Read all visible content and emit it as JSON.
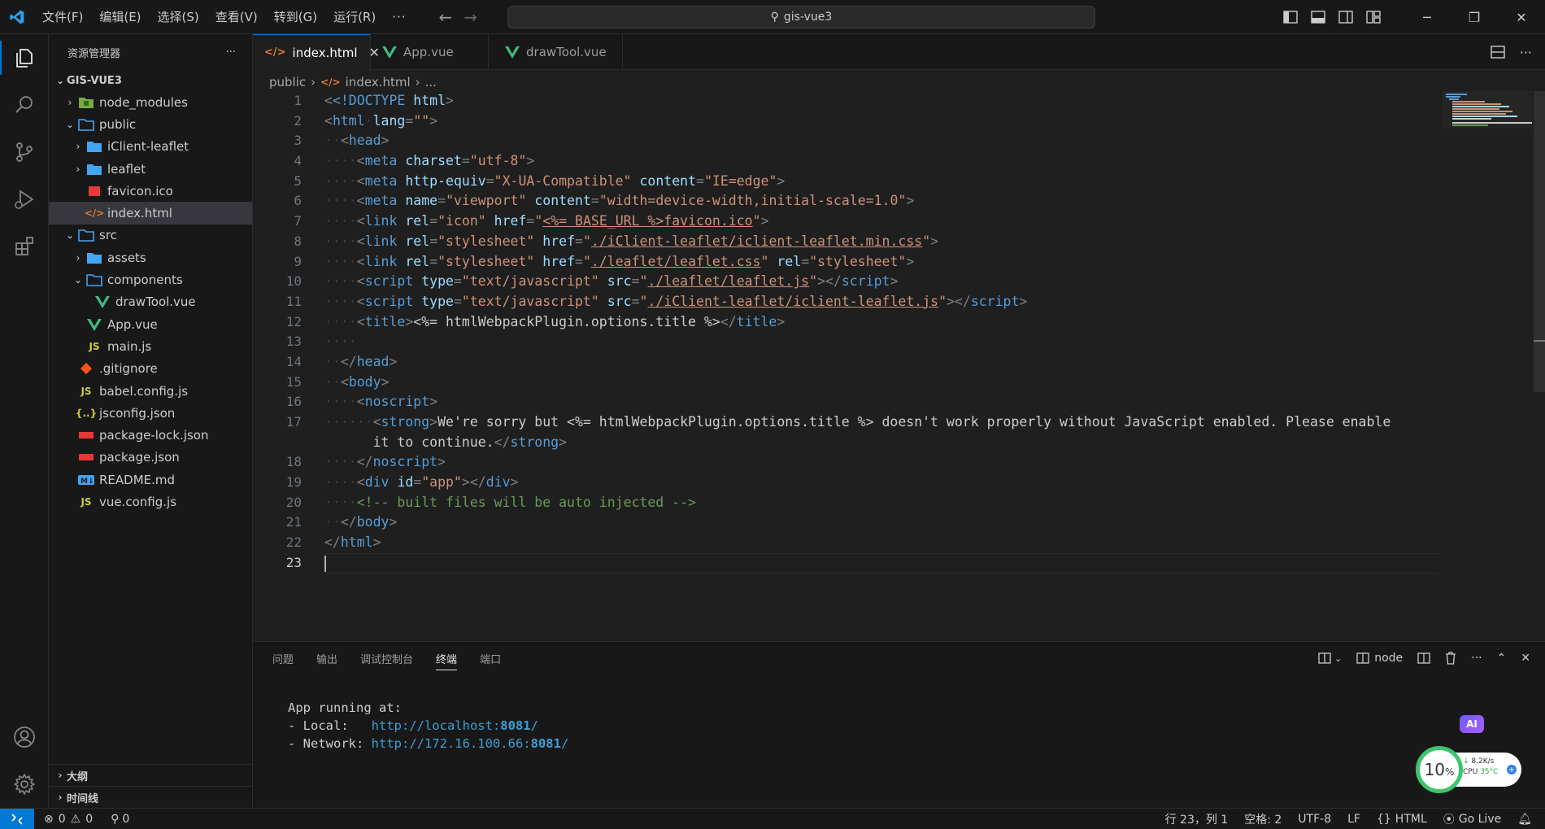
{
  "menu": [
    "文件(F)",
    "编辑(E)",
    "选择(S)",
    "查看(V)",
    "转到(G)",
    "运行(R)",
    "···"
  ],
  "search": {
    "text": "gis-vue3"
  },
  "explorer": {
    "title": "资源管理器",
    "root": "GIS-VUE3",
    "items": [
      {
        "label": "node_modules"
      },
      {
        "label": "public"
      },
      {
        "label": "iClient-leaflet"
      },
      {
        "label": "leaflet"
      },
      {
        "label": "favicon.ico"
      },
      {
        "label": "index.html"
      },
      {
        "label": "src"
      },
      {
        "label": "assets"
      },
      {
        "label": "components"
      },
      {
        "label": "drawTool.vue"
      },
      {
        "label": "App.vue"
      },
      {
        "label": "main.js"
      },
      {
        "label": ".gitignore"
      },
      {
        "label": "babel.config.js"
      },
      {
        "label": "jsconfig.json"
      },
      {
        "label": "package-lock.json"
      },
      {
        "label": "package.json"
      },
      {
        "label": "README.md"
      },
      {
        "label": "vue.config.js"
      }
    ],
    "outline": "大纲",
    "timeline": "时间线"
  },
  "tabs": [
    {
      "label": "index.html"
    },
    {
      "label": "App.vue"
    },
    {
      "label": "drawTool.vue"
    }
  ],
  "breadcrumb": {
    "folder": "public",
    "file": "index.html",
    "more": "..."
  },
  "editor": {
    "line_numbers": [
      "1",
      "2",
      "3",
      "4",
      "5",
      "6",
      "7",
      "8",
      "9",
      "10",
      "11",
      "12",
      "13",
      "14",
      "15",
      "16",
      "17",
      "",
      "18",
      "19",
      "20",
      "21",
      "22",
      "23"
    ],
    "code": {
      "doctype": "<!DOCTYPE",
      "doctype_kw": "html",
      "html": "html",
      "lang": "lang",
      "empty": "\"\"",
      "head": "head",
      "meta": "meta",
      "charset": "charset",
      "utf8": "\"utf-8\"",
      "http_equiv": "http-equiv",
      "xua": "\"X-UA-Compatible\"",
      "content": "content",
      "ieedge": "\"IE=edge\"",
      "name": "name",
      "viewport": "\"viewport\"",
      "vpcontent": "\"width=device-width,initial-scale=1.0\"",
      "link": "link",
      "rel": "rel",
      "icon": "\"icon\"",
      "href": "href",
      "fav": "<%= BASE_URL %>favicon.ico",
      "stylesheet": "\"stylesheet\"",
      "iclient_css": "./iClient-leaflet/iclient-leaflet.min.css",
      "leaflet_css": "./leaflet/leaflet.css",
      "script": "script",
      "type": "type",
      "tjs": "\"text/javascript\"",
      "src": "src",
      "leaflet_js": "./leaflet/leaflet.js",
      "iclient_js": "./iClient-leaflet/iclient-leaflet.js",
      "title": "title",
      "title_expr": "<%= htmlWebpackPlugin.options.title %>",
      "body": "body",
      "noscript": "noscript",
      "strong": "strong",
      "sorry_1": "We're sorry but <%= htmlWebpackPlugin.options.title %> doesn't work properly without JavaScript enabled. Please enable",
      "sorry_2": "it to continue.",
      "div": "div",
      "id": "id",
      "app": "\"app\"",
      "comment": "<!-- built files will be auto injected -->"
    }
  },
  "panel": {
    "tabs": [
      "问题",
      "输出",
      "调试控制台",
      "终端",
      "端口"
    ],
    "active_tab": "终端",
    "terminal_name": "node",
    "lines": {
      "l1": "App running at:",
      "local_label": "- Local:   ",
      "local_url": "http://localhost:",
      "local_port": "8081",
      "network_label": "- Network: ",
      "network_url": "http://172.16.100.66:",
      "network_port": "8081"
    },
    "ai_badge": "AI",
    "cpu_percent": "10",
    "cpu_unit": "%",
    "net_speed": "8.2K/s",
    "cpu_label": "CPU",
    "cpu_temp": "35°C"
  },
  "statusbar": {
    "errors": "0",
    "warnings": "0",
    "ports": "0",
    "position": "行 23，列 1",
    "spaces": "空格: 2",
    "encoding": "UTF-8",
    "eol": "LF",
    "language": "HTML",
    "golive": "Go Live"
  },
  "colors": {
    "accent": "#0078d4",
    "tag": "#569cd6",
    "attr": "#9cdcfe",
    "string": "#ce9178",
    "comment": "#6a9955"
  }
}
